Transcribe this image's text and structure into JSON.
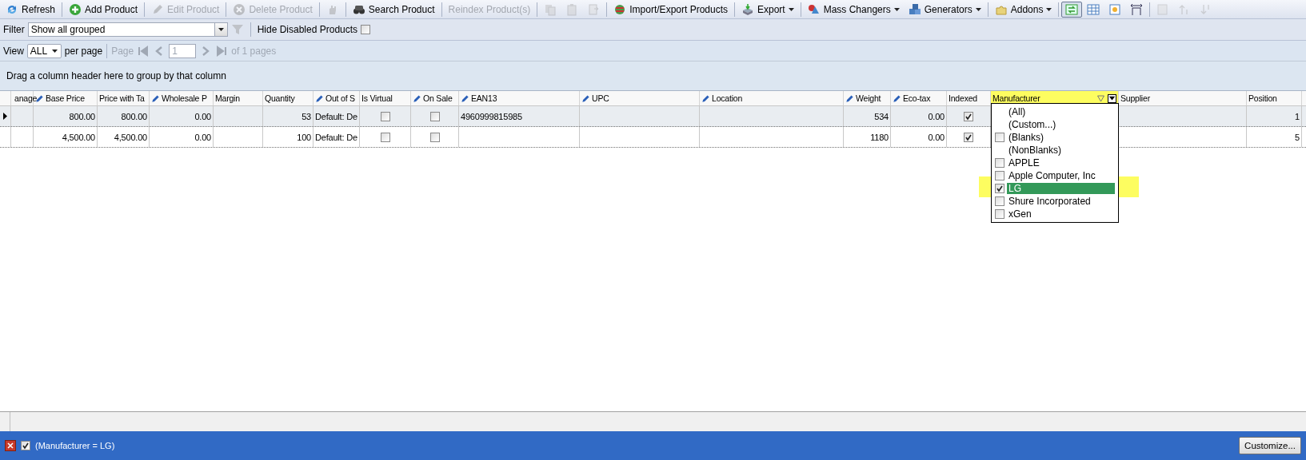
{
  "toolbar": {
    "items": [
      {
        "kind": "button",
        "label": "Refresh",
        "disabled": false
      },
      {
        "kind": "separator"
      },
      {
        "kind": "button",
        "label": "Add Product",
        "disabled": false
      },
      {
        "kind": "separator"
      },
      {
        "kind": "button",
        "label": "Edit Product",
        "disabled": true
      },
      {
        "kind": "separator"
      },
      {
        "kind": "button",
        "label": "Delete Product",
        "disabled": true
      },
      {
        "kind": "separator"
      },
      {
        "kind": "icon",
        "disabled": true
      },
      {
        "kind": "separator"
      },
      {
        "kind": "button",
        "label": "Search Product",
        "disabled": false
      },
      {
        "kind": "separator"
      },
      {
        "kind": "button",
        "label": "Reindex Product(s)",
        "disabled": true
      },
      {
        "kind": "separator"
      },
      {
        "kind": "icon",
        "disabled": true
      },
      {
        "kind": "icon",
        "disabled": true
      },
      {
        "kind": "icon",
        "disabled": true
      },
      {
        "kind": "separator"
      },
      {
        "kind": "button",
        "label": "Import/Export Products",
        "disabled": false
      },
      {
        "kind": "separator"
      },
      {
        "kind": "menu",
        "label": "Export",
        "disabled": false
      },
      {
        "kind": "separator"
      },
      {
        "kind": "menu",
        "label": "Mass Changers",
        "disabled": false
      },
      {
        "kind": "menu",
        "label": "Generators",
        "disabled": false
      },
      {
        "kind": "separator"
      },
      {
        "kind": "menu",
        "label": "Addons",
        "disabled": false
      },
      {
        "kind": "separator"
      },
      {
        "kind": "icon",
        "disabled": false,
        "selected": true
      },
      {
        "kind": "icon",
        "disabled": false,
        "selected": false
      },
      {
        "kind": "icon",
        "disabled": false,
        "selected": false
      },
      {
        "kind": "icon",
        "disabled": false,
        "selected": false
      },
      {
        "kind": "separator"
      },
      {
        "kind": "icon",
        "disabled": true
      },
      {
        "kind": "icon",
        "disabled": true
      },
      {
        "kind": "icon",
        "disabled": true
      }
    ]
  },
  "filter_bar": {
    "label": "Filter",
    "value": "Show all grouped",
    "hide_label": "Hide Disabled Products",
    "hide_checked": false
  },
  "pager": {
    "view_label": "View",
    "per_page_value": "ALL",
    "per_page_label": "per page",
    "page_label": "Page",
    "page_value": "1",
    "pages_text": "of 1 pages"
  },
  "group_panel": {
    "text": "Drag a column header here to group by that column"
  },
  "table": {
    "columns": [
      {
        "label": "anage",
        "kind": "chooser"
      },
      {
        "label": "Base Price",
        "kind": "editable"
      },
      {
        "label": "Price with Ta",
        "kind": "plain"
      },
      {
        "label": "Wholesale P",
        "kind": "editable"
      },
      {
        "label": "Margin",
        "kind": "plain"
      },
      {
        "label": "Quantity",
        "kind": "plain"
      },
      {
        "label": "Out of S",
        "kind": "editable"
      },
      {
        "label": "Is Virtual",
        "kind": "plain"
      },
      {
        "label": "On Sale",
        "kind": "editable"
      },
      {
        "label": "EAN13",
        "kind": "editable"
      },
      {
        "label": "UPC",
        "kind": "editable"
      },
      {
        "label": "Location",
        "kind": "editable"
      },
      {
        "label": "Weight",
        "kind": "editable"
      },
      {
        "label": "Eco-tax",
        "kind": "editable"
      },
      {
        "label": "Indexed",
        "kind": "plain"
      },
      {
        "label": "Manufacturer",
        "kind": "filtered",
        "highlighted": true
      },
      {
        "label": "Supplier",
        "kind": "plain"
      },
      {
        "label": "Position",
        "kind": "plain"
      }
    ],
    "rows": [
      {
        "selected": true,
        "cells": [
          null,
          "800.00",
          "800.00",
          "0.00",
          null,
          "53",
          "Default: De",
          {
            "checked": false
          },
          {
            "checked": false
          },
          "4960999815985",
          null,
          null,
          "534",
          "0.00",
          {
            "checked": true
          },
          null,
          null,
          "1"
        ]
      },
      {
        "selected": false,
        "cells": [
          null,
          "4,500.00",
          "4,500.00",
          "0.00",
          null,
          "100",
          "Default: De",
          {
            "checked": false
          },
          {
            "checked": false
          },
          null,
          null,
          null,
          "1180",
          "0.00",
          {
            "checked": true
          },
          null,
          null,
          "5"
        ]
      }
    ]
  },
  "filter_menu": {
    "items": [
      {
        "kind": "action",
        "label": "(All)"
      },
      {
        "kind": "action",
        "label": "(Custom...)"
      },
      {
        "kind": "value",
        "label": "(Blanks)",
        "checked": false,
        "selected": false,
        "highlighted": false
      },
      {
        "kind": "action",
        "label": "(NonBlanks)"
      },
      {
        "kind": "value",
        "label": "APPLE",
        "checked": false,
        "selected": false,
        "highlighted": false
      },
      {
        "kind": "value",
        "label": "Apple Computer, Inc",
        "checked": false,
        "selected": false,
        "highlighted": false
      },
      {
        "kind": "value",
        "label": "LG",
        "checked": true,
        "selected": true,
        "highlighted": true
      },
      {
        "kind": "value",
        "label": "Shure Incorporated",
        "checked": false,
        "selected": false,
        "highlighted": false
      },
      {
        "kind": "value",
        "label": "xGen",
        "checked": false,
        "selected": false,
        "highlighted": false
      }
    ]
  },
  "filter_status": {
    "enabled": true,
    "text": "(Manufacturer = LG)",
    "customize_label": "Customize..."
  }
}
